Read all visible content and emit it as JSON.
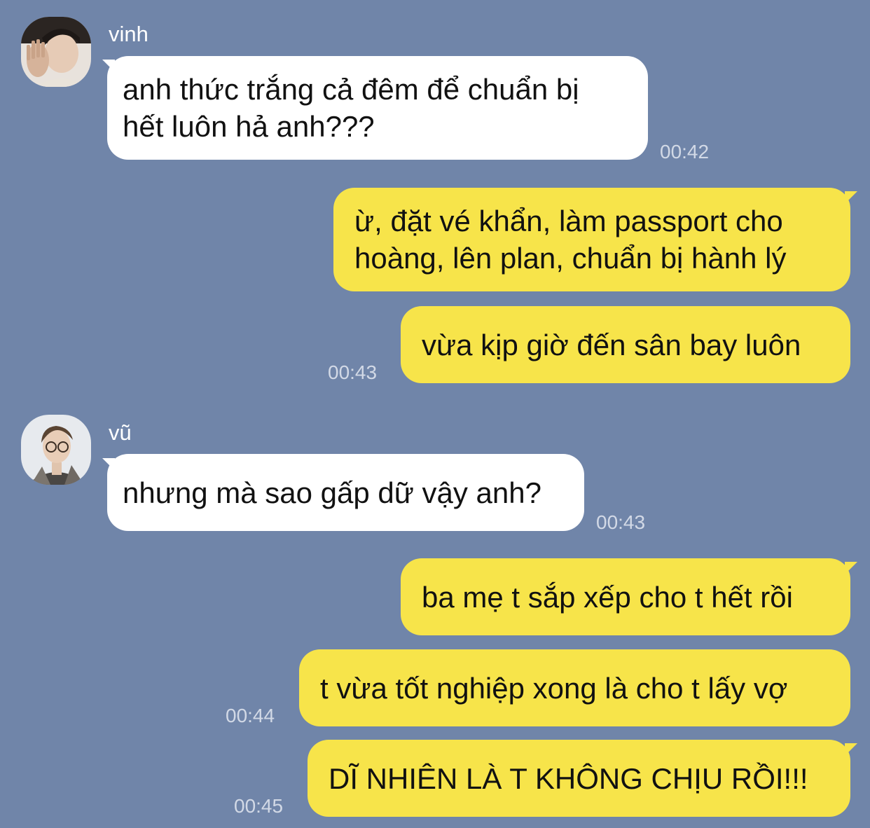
{
  "messages": [
    {
      "sender": "vinh",
      "text_lines": [
        "anh thức trắng cả đêm để chuẩn bị",
        "hết luôn hả anh???"
      ],
      "time": "00:42"
    },
    {
      "sender": "me",
      "text_lines": [
        "ừ, đặt vé khẩn, làm passport cho",
        "hoàng, lên plan, chuẩn bị hành lý"
      ]
    },
    {
      "sender": "me",
      "text": "vừa kịp giờ đến sân bay luôn",
      "time": "00:43"
    },
    {
      "sender": "vũ",
      "text": "nhưng mà sao gấp dữ vậy anh?",
      "time": "00:43"
    },
    {
      "sender": "me",
      "text": "ba mẹ t sắp xếp cho t hết rồi"
    },
    {
      "sender": "me",
      "text": "t vừa tốt nghiệp xong là cho t lấy vợ",
      "time": "00:44"
    },
    {
      "sender": "me",
      "text": "DĨ NHIÊN LÀ T KHÔNG CHỊU RỒI!!!",
      "time": "00:45"
    }
  ],
  "colors": {
    "background": "#7085a9",
    "incoming_bubble": "#ffffff",
    "outgoing_bubble": "#f7e44a",
    "timestamp": "#d2d9e6"
  }
}
